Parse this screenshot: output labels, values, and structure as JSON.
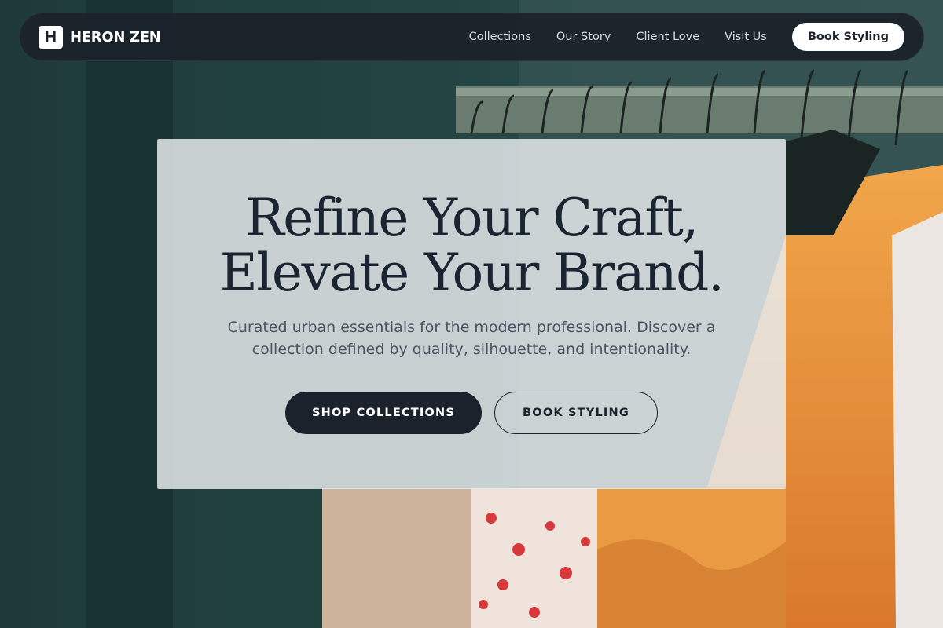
{
  "brand": {
    "mark": "H",
    "name": "HERON ZEN"
  },
  "nav": {
    "links": [
      "Collections",
      "Our Story",
      "Client Love",
      "Visit Us"
    ],
    "cta": "Book Styling"
  },
  "hero": {
    "title_line1": "Refine Your Craft,",
    "title_line2": "Elevate Your Brand.",
    "subtitle": "Curated urban essentials for the modern professional. Discover a collection defined by quality, silhouette, and intentionality.",
    "primary_button": "SHOP COLLECTIONS",
    "secondary_button": "BOOK STYLING"
  },
  "colors": {
    "dark": "#1b222b",
    "wall": "#1e3b3a",
    "garment_orange": "#e8943a"
  },
  "background": {
    "description_icon": "clothing-rack-photo"
  }
}
